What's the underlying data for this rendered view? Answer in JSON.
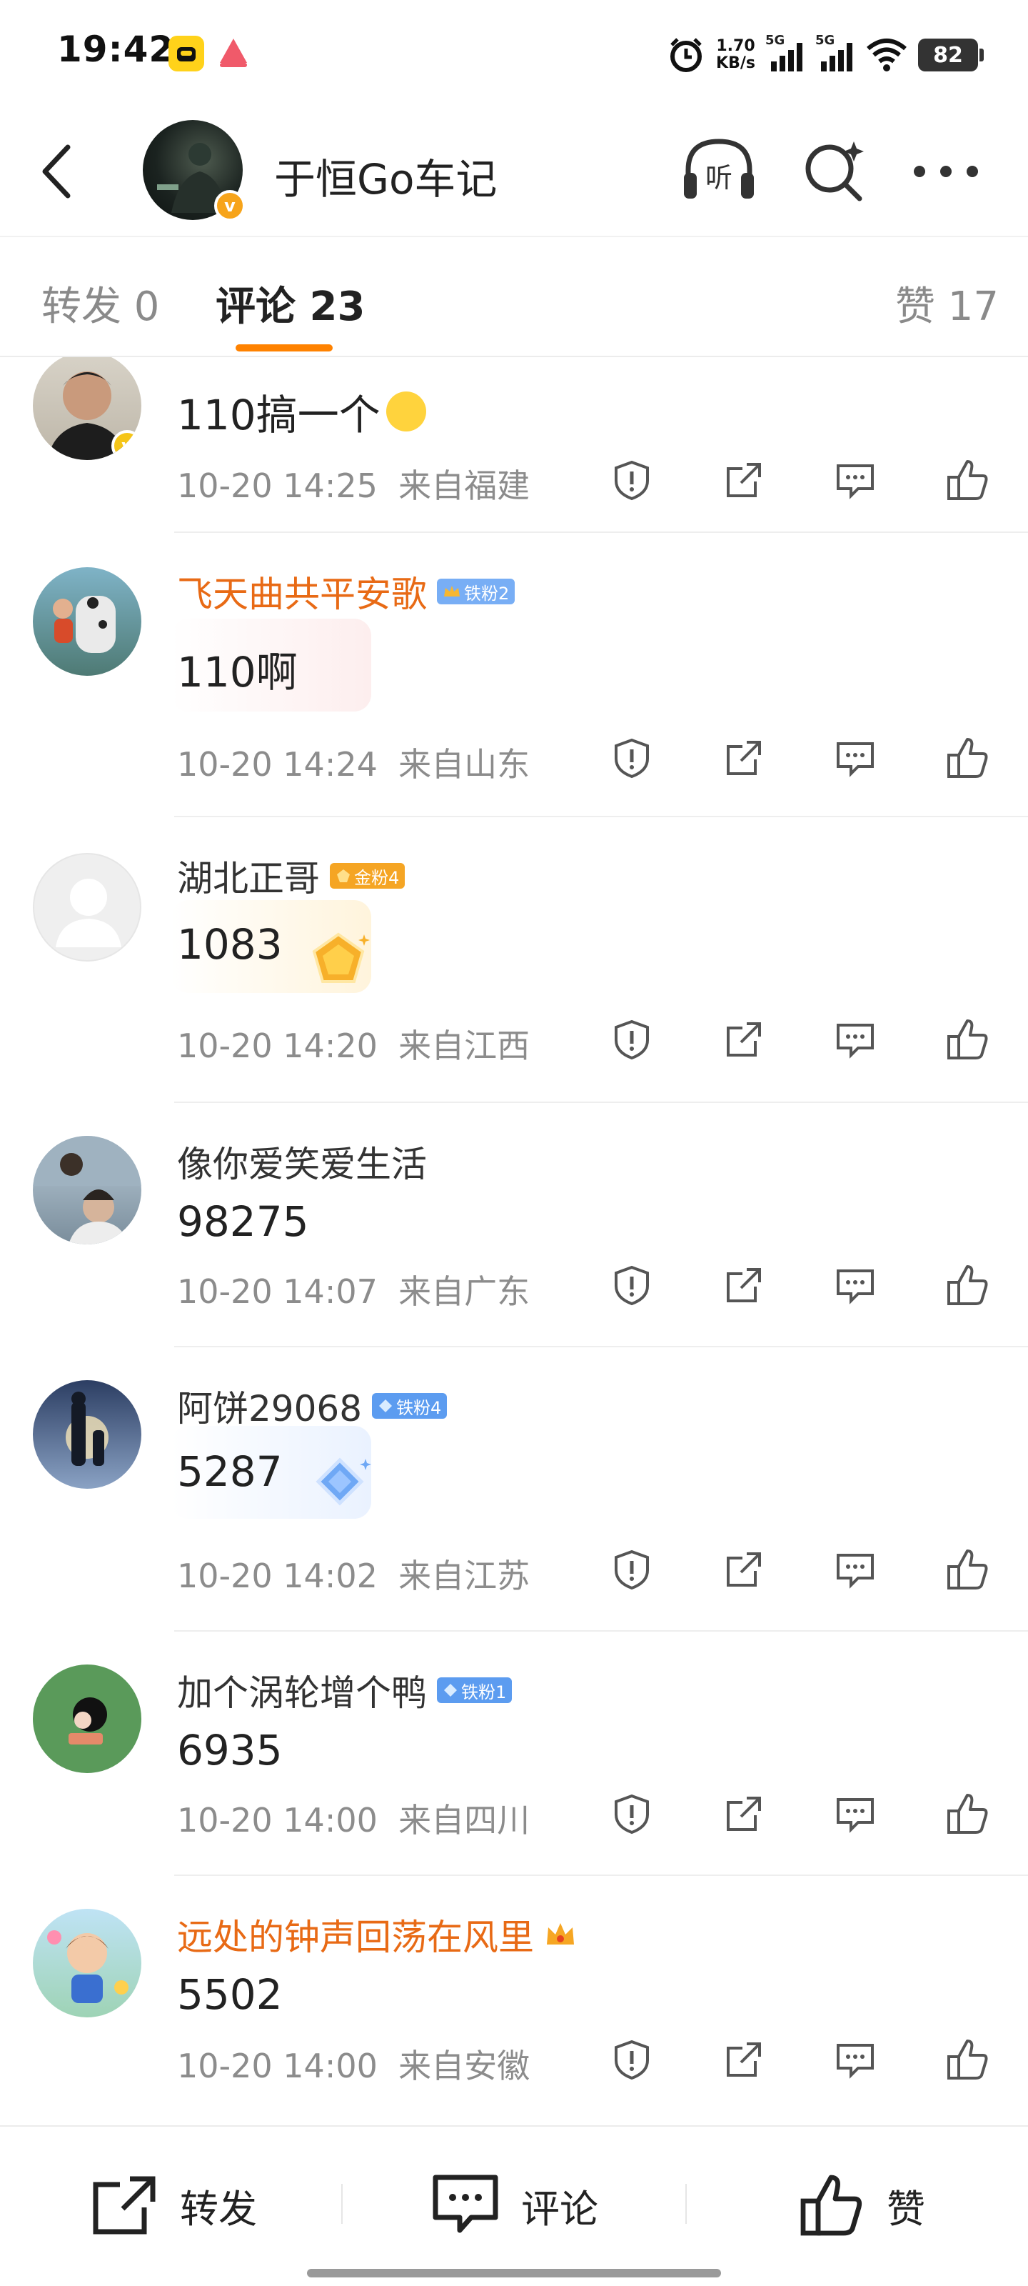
{
  "status_bar": {
    "time": "19:42",
    "net_speed_value": "1.70",
    "net_speed_unit": "KB/s",
    "sim1": "5G",
    "sim2": "5G",
    "battery": "82"
  },
  "header": {
    "title": "于恒Go车记",
    "listen_label": "听"
  },
  "tabs": [
    {
      "label": "转发 0"
    },
    {
      "label": "评论 23"
    },
    {
      "label": "赞 17"
    }
  ],
  "comments": [
    {
      "username": "",
      "text": "110搞一个",
      "time": "10-20 14:25",
      "location": "来自福建"
    },
    {
      "username": "飞天曲共平安歌",
      "badge": "铁粉2",
      "text": "110啊",
      "time": "10-20 14:24",
      "location": "来自山东"
    },
    {
      "username": "湖北正哥",
      "badge": "金粉4",
      "text": "1083",
      "time": "10-20 14:20",
      "location": "来自江西"
    },
    {
      "username": "像你爱笑爱生活",
      "text": "98275",
      "time": "10-20 14:07",
      "location": "来自广东"
    },
    {
      "username": "阿饼29068",
      "badge": "铁粉4",
      "text": "5287",
      "time": "10-20 14:02",
      "location": "来自江苏"
    },
    {
      "username": "加个涡轮增个鸭",
      "badge": "铁粉1",
      "text": "6935",
      "time": "10-20 14:00",
      "location": "来自四川"
    },
    {
      "username": "远处的钟声回荡在风里",
      "text": "5502",
      "time": "10-20 14:00",
      "location": "来自安徽"
    }
  ],
  "bottom_bar": {
    "repost": "转发",
    "comment": "评论",
    "like": "赞"
  },
  "colors": {
    "accent": "#ff8200",
    "vip_name": "#e86a15",
    "meta_gray": "#8c8c8c"
  }
}
